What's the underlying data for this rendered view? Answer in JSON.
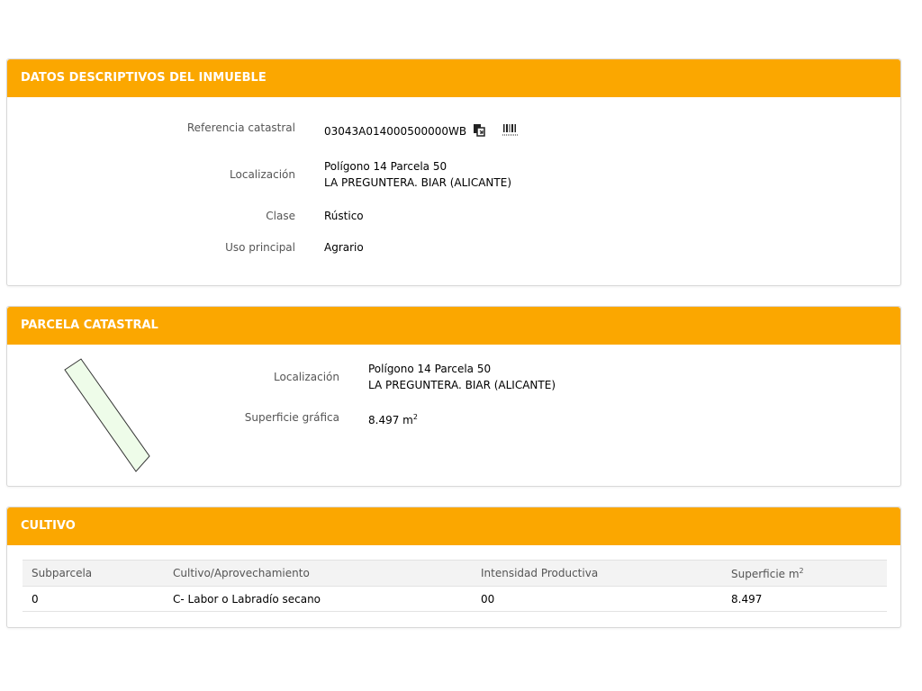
{
  "descriptivos": {
    "title": "DATOS DESCRIPTIVOS DEL INMUEBLE",
    "referencia_label": "Referencia catastral",
    "referencia_value": "03043A014000500000WB",
    "localizacion_label": "Localización",
    "localizacion_line1": "Polígono 14 Parcela 50",
    "localizacion_line2": "LA PREGUNTERA. BIAR (ALICANTE)",
    "clase_label": "Clase",
    "clase_value": "Rústico",
    "uso_label": "Uso principal",
    "uso_value": "Agrario",
    "icons": [
      "copy-icon",
      "barcode-icon"
    ]
  },
  "parcela": {
    "title": "PARCELA CATASTRAL",
    "localizacion_label": "Localización",
    "localizacion_line1": "Polígono 14 Parcela 50",
    "localizacion_line2": "LA PREGUNTERA. BIAR (ALICANTE)",
    "superficie_label": "Superficie gráfica",
    "superficie_value": "8.497 m",
    "superficie_sup": "2",
    "shape_fill": "#eefce9",
    "shape_stroke": "#333333"
  },
  "cultivo": {
    "title": "CULTIVO",
    "headers": {
      "subparcela": "Subparcela",
      "cultivo": "Cultivo/Aprovechamiento",
      "intensidad": "Intensidad Productiva",
      "superficie": "Superficie m",
      "superficie_sup": "2"
    },
    "rows": [
      {
        "subparcela": "0",
        "cultivo": "C- Labor o Labradío secano",
        "intensidad": "00",
        "superficie": "8.497"
      }
    ]
  },
  "colors": {
    "header_bg": "#fba700",
    "header_text": "#ffffff"
  }
}
